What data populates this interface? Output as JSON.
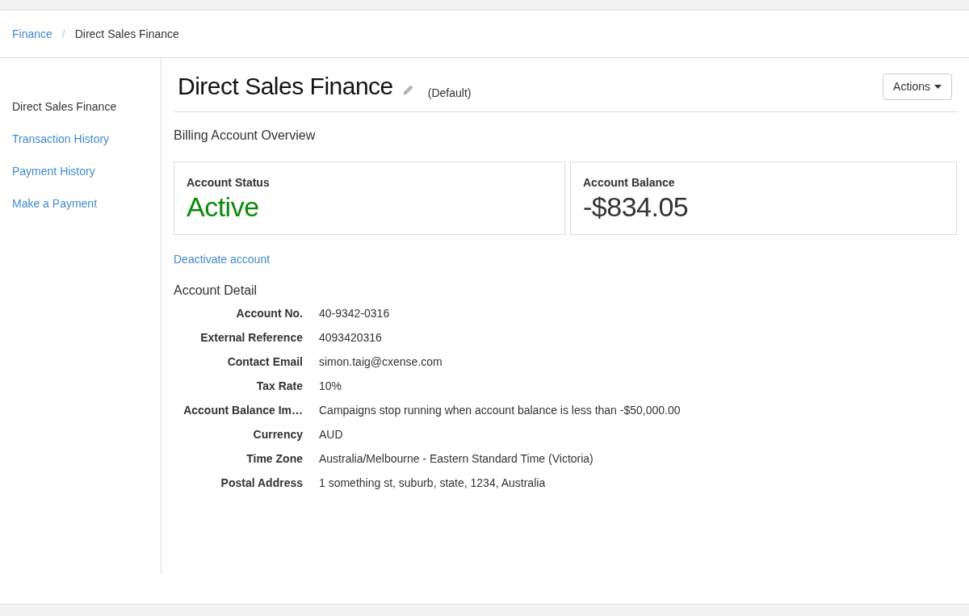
{
  "breadcrumb": {
    "separator": "/",
    "items": [
      {
        "label": "Finance",
        "kind": "link"
      },
      {
        "label": "Direct Sales Finance",
        "kind": "current"
      }
    ]
  },
  "sidebar": {
    "items": [
      {
        "label": "Direct Sales Finance",
        "selected": true
      },
      {
        "label": "Transaction History",
        "selected": false
      },
      {
        "label": "Payment History",
        "selected": false
      },
      {
        "label": "Make a Payment",
        "selected": false
      }
    ]
  },
  "header": {
    "title": "Direct Sales Finance",
    "badge": "(Default)",
    "actions_button": "Actions"
  },
  "overview": {
    "heading": "Billing Account Overview",
    "cards": [
      {
        "kind": "status",
        "label": "Account Status",
        "value": "Active"
      },
      {
        "kind": "amount",
        "label": "Account Balance",
        "value": "-$834.05"
      }
    ]
  },
  "deactivate_link": "Deactivate account",
  "detail": {
    "heading": "Account Detail",
    "rows": [
      {
        "label": "Account No.",
        "value": "40-9342-0316"
      },
      {
        "label": "External Reference",
        "value": "4093420316"
      },
      {
        "label": "Contact Email",
        "value": "simon.taig@cxense.com"
      },
      {
        "label": "Tax Rate",
        "value": "10%"
      },
      {
        "label": "Account Balance Im…",
        "value": "Campaigns stop running when account balance is less than -$50,000.00"
      },
      {
        "label": "Currency",
        "value": "AUD"
      },
      {
        "label": "Time Zone",
        "value": "Australia/Melbourne - Eastern Standard Time (Victoria)"
      },
      {
        "label": "Postal Address",
        "value": "1 something st, suburb, state, 1234, Australia"
      }
    ]
  }
}
